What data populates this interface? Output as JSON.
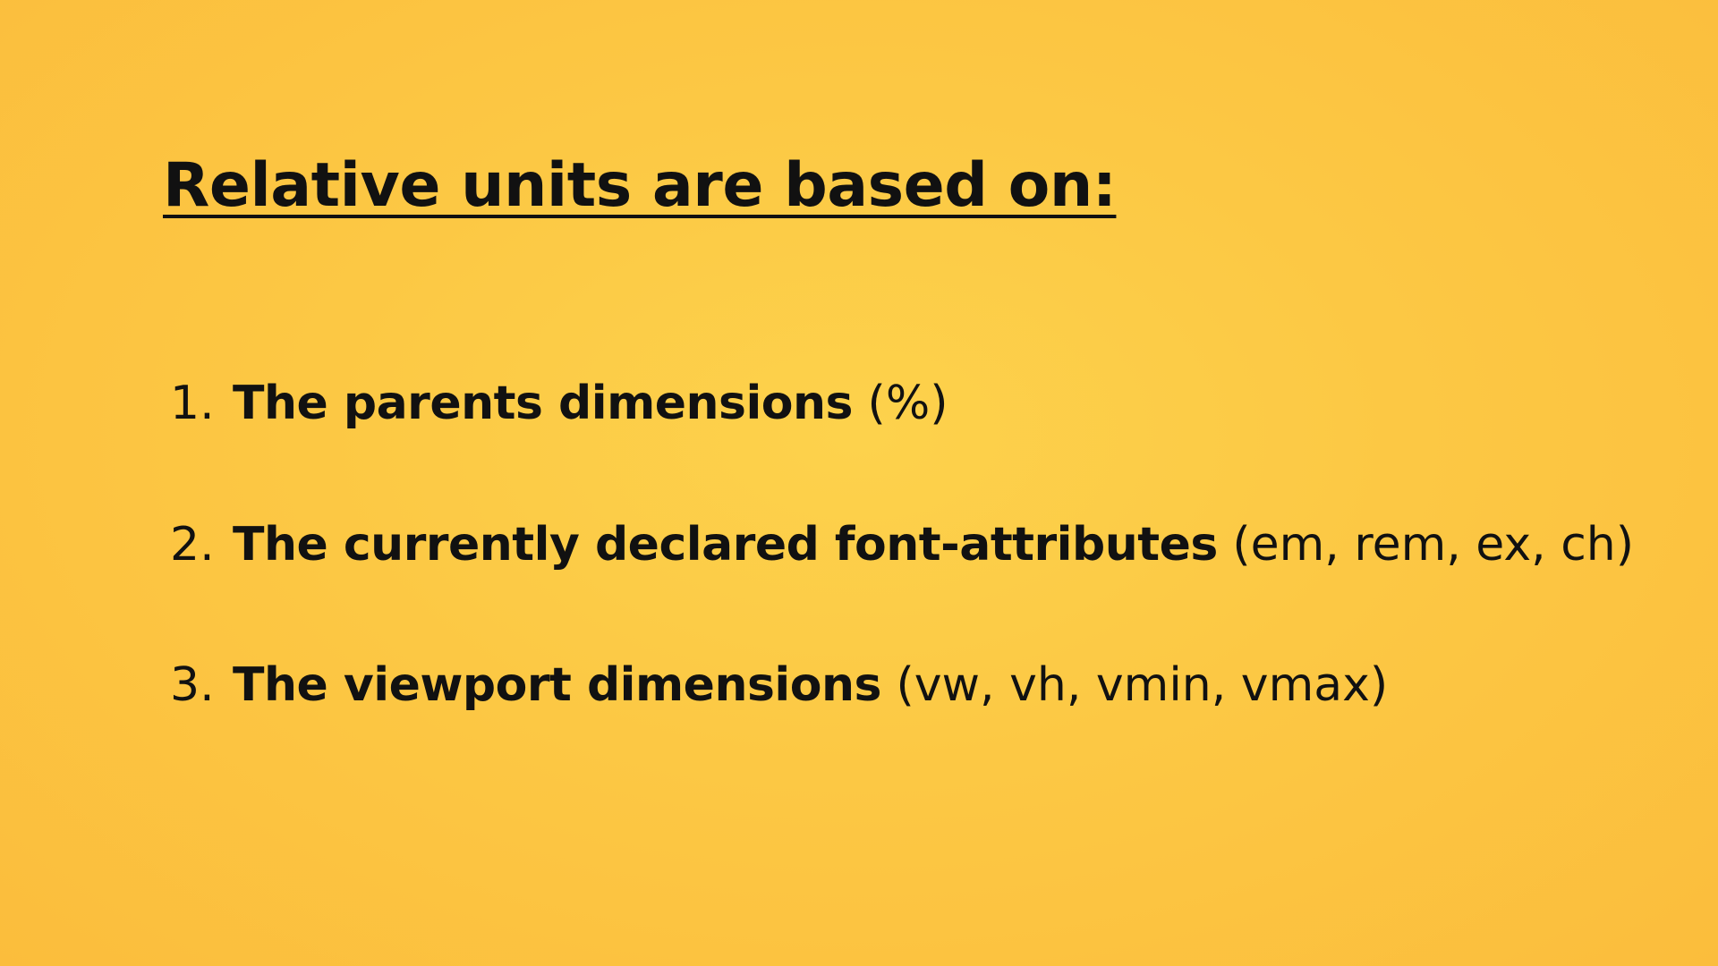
{
  "slide": {
    "heading": "Relative units are based on:",
    "items": [
      {
        "number": "1.",
        "bold": "The parents dimensions",
        "units": "(%)"
      },
      {
        "number": "2.",
        "bold": "The currently declared font-attributes",
        "units": "(em, rem, ex, ch)"
      },
      {
        "number": "3.",
        "bold": "The viewport dimensions",
        "units": "(vw, vh, vmin, vmax)"
      }
    ],
    "colors": {
      "background": "#fcc844",
      "text": "#111111"
    }
  }
}
